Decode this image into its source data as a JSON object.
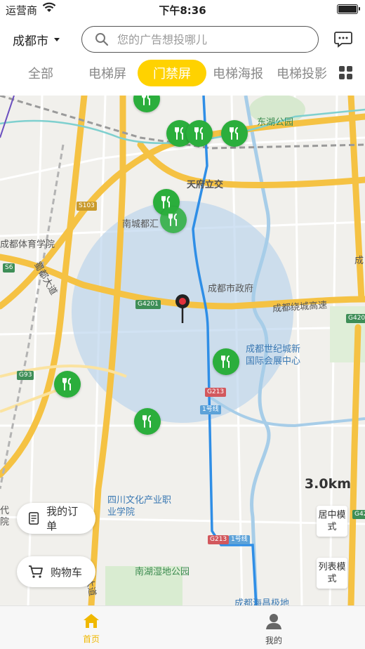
{
  "status_bar": {
    "carrier": "运营商",
    "time": "下午8:36"
  },
  "header": {
    "city": "成都市",
    "search_placeholder": "您的广告想投哪儿"
  },
  "tabs": [
    {
      "label": "全部",
      "active": false
    },
    {
      "label": "电梯屏",
      "active": false
    },
    {
      "label": "门禁屏",
      "active": true
    },
    {
      "label": "电梯海报",
      "active": false
    },
    {
      "label": "电梯投影",
      "active": false
    }
  ],
  "map": {
    "labels": {
      "donghu": "东湖公园",
      "tianfu": "天府立交",
      "nancheng": "南城都汇",
      "sports": "成都体育学院",
      "avenue": "蜀都大道",
      "gov": "成都市政府",
      "ring": "成都绕城高速",
      "expo": "成都世纪城新国际会展中心",
      "line1": "1号线",
      "line1b": "1号线",
      "college": "四川文化产业职业学院",
      "wetland": "南湖湿地公园",
      "haichang": "成都海昌极地",
      "edge_cheng": "成",
      "edge_dai": "代",
      "edge_yuan": "院",
      "edge_da": "大道"
    },
    "shields": {
      "s103": "S103",
      "s6": "S6",
      "g4201": "G4201",
      "g4201b": "G4201",
      "g93": "G93",
      "g213": "G213",
      "g213b": "G213",
      "g42": "G42"
    },
    "scale": "3.0km",
    "accent_color": "#ffd200",
    "poi_color": "#2bae3c",
    "radius_circle_color": "#b9d3ec"
  },
  "buttons": {
    "orders": "我的订单",
    "cart": "购物车",
    "center_mode": "居中模式",
    "list_mode": "列表模式"
  },
  "tabbar": {
    "home": "首页",
    "mine": "我的"
  }
}
